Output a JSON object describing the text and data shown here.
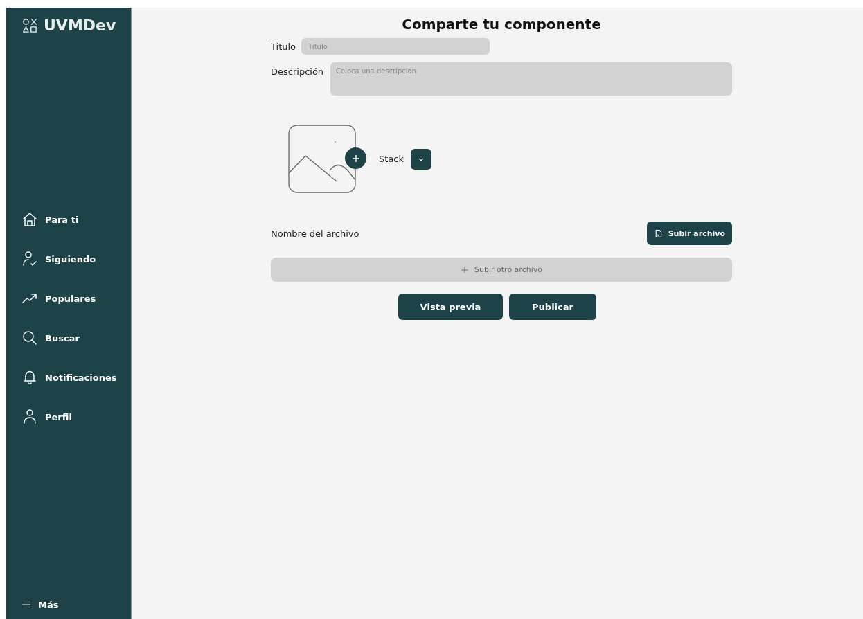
{
  "sidebar": {
    "logo": "UVMDev",
    "items": [
      {
        "kind": "home",
        "label": "Para ti"
      },
      {
        "kind": "following",
        "label": "Siguiendo"
      },
      {
        "kind": "trending",
        "label": "Populares"
      },
      {
        "kind": "search",
        "label": "Buscar"
      },
      {
        "kind": "bell",
        "label": "Notificaciones"
      },
      {
        "kind": "profile",
        "label": "Perfil"
      }
    ],
    "more": "Más"
  },
  "form": {
    "heading": "Comparte tu componente",
    "title_field": {
      "label": "Titulo",
      "placeholder": "Titulo"
    },
    "description_field": {
      "label": "Descripción",
      "placeholder": "Coloca una descripcion"
    },
    "stack": {
      "label": "Stack"
    },
    "file": {
      "name": "Nombre del archivo",
      "upload": "Subir archivo"
    },
    "add_file": "Subir otro archivo",
    "buttons": [
      "Vista previa",
      "Publicar"
    ]
  }
}
